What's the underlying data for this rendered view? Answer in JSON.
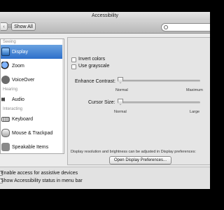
{
  "window": {
    "title": "Accessibility"
  },
  "toolbar": {
    "show_all": "Show All",
    "search_placeholder": ""
  },
  "sidebar": {
    "sections": {
      "seeing": "Seeing",
      "hearing": "Hearing",
      "interacting": "Interacting"
    },
    "items": [
      {
        "label": "Display",
        "icon": "display-icon",
        "selected": true
      },
      {
        "label": "Zoom",
        "icon": "zoom-icon"
      },
      {
        "label": "VoiceOver",
        "icon": "voiceover-icon"
      },
      {
        "label": "Audio",
        "icon": "speaker-icon"
      },
      {
        "label": "Keyboard",
        "icon": "keyboard-icon"
      },
      {
        "label": "Mouse & Trackpad",
        "icon": "mouse-icon"
      },
      {
        "label": "Speakable Items",
        "icon": "speakable-icon"
      }
    ]
  },
  "display": {
    "invert_colors": "Invert colors",
    "use_grayscale": "Use grayscale",
    "enhance_contrast": "Enhance Contrast:",
    "contrast_min": "Normal",
    "contrast_max": "Maximum",
    "contrast_level": 0,
    "cursor_size": "Cursor Size:",
    "cursor_min": "Normal",
    "cursor_max": "Large",
    "cursor_level": 0,
    "note": "Display resolution and brightness can be adjusted in Display preferences:",
    "open_button": "Open Display Preferences..."
  },
  "footer": {
    "assistive": "Enable access for assistive devices",
    "status_menu": "Show Accessibility status in menu bar"
  },
  "colors": {
    "selection": "#3b7bd4",
    "window": "#ececec"
  }
}
